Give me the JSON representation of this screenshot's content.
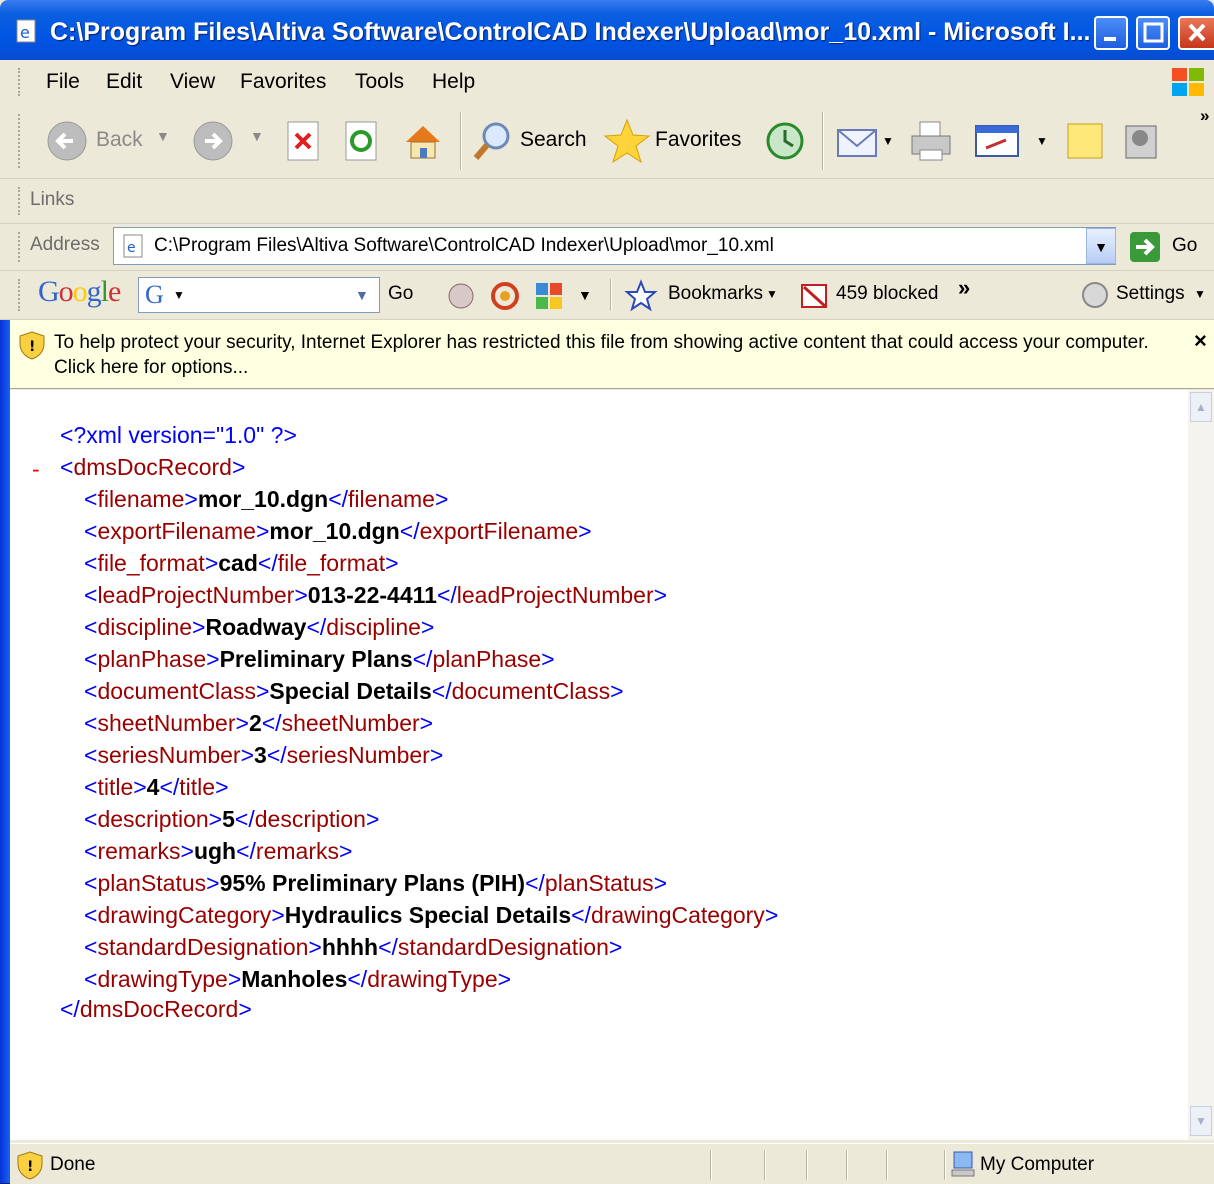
{
  "window": {
    "title": "C:\\Program Files\\Altiva Software\\ControlCAD Indexer\\Upload\\mor_10.xml - Microsoft I..."
  },
  "menu": {
    "items": [
      "File",
      "Edit",
      "View",
      "Favorites",
      "Tools",
      "Help"
    ]
  },
  "toolbar": {
    "back": "Back",
    "search": "Search",
    "favorites": "Favorites"
  },
  "links": {
    "label": "Links"
  },
  "address": {
    "label": "Address",
    "value": "C:\\Program Files\\Altiva Software\\ControlCAD Indexer\\Upload\\mor_10.xml",
    "go": "Go"
  },
  "google": {
    "logo": "Google",
    "go": "Go",
    "bookmarks": "Bookmarks",
    "blocked": "459 blocked",
    "settings": "Settings"
  },
  "infobar": {
    "text": "To help protect your security, Internet Explorer has restricted this file from showing active content that could access your computer. Click here for options...",
    "close": "×"
  },
  "xml": {
    "declaration": "<?xml version=\"1.0\" ?>",
    "root": "dmsDocRecord",
    "collapse": "-",
    "elements": [
      {
        "tag": "filename",
        "value": "mor_10.dgn"
      },
      {
        "tag": "exportFilename",
        "value": "mor_10.dgn"
      },
      {
        "tag": "file_format",
        "value": "cad"
      },
      {
        "tag": "leadProjectNumber",
        "value": "013-22-4411"
      },
      {
        "tag": "discipline",
        "value": "Roadway"
      },
      {
        "tag": "planPhase",
        "value": "Preliminary Plans"
      },
      {
        "tag": "documentClass",
        "value": "Special Details"
      },
      {
        "tag": "sheetNumber",
        "value": "2"
      },
      {
        "tag": "seriesNumber",
        "value": "3"
      },
      {
        "tag": "title",
        "value": "4"
      },
      {
        "tag": "description",
        "value": "5"
      },
      {
        "tag": "remarks",
        "value": "ugh"
      },
      {
        "tag": "planStatus",
        "value": "95% Preliminary Plans (PIH)"
      },
      {
        "tag": "drawingCategory",
        "value": "Hydraulics Special Details"
      },
      {
        "tag": "standardDesignation",
        "value": "hhhh"
      },
      {
        "tag": "drawingType",
        "value": "Manholes"
      }
    ]
  },
  "status": {
    "left": "Done",
    "zone": "My Computer"
  },
  "colors": {
    "titlebar": "#0054e3",
    "tag_bracket": "#0000ff",
    "tag_name": "#990000",
    "infobar": "#ffffe1"
  }
}
